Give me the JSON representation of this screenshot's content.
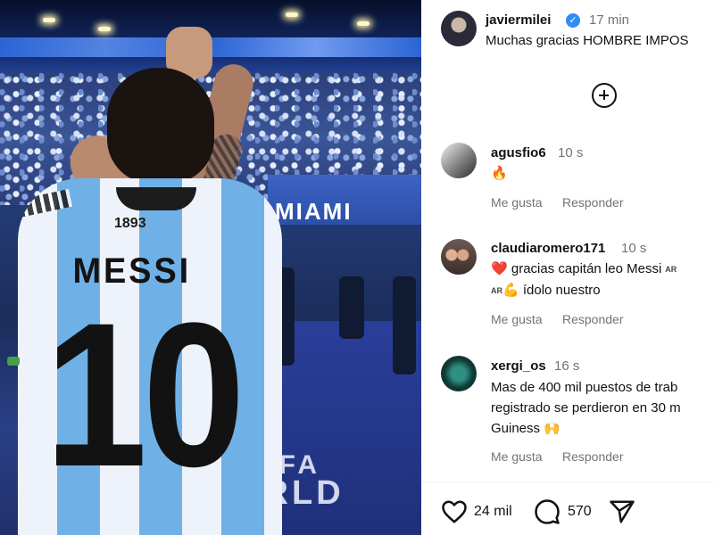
{
  "photo": {
    "banner_text": "MIAMI",
    "field_text_1": "FIFA",
    "field_text_2": "ORLD",
    "jersey_crest": "1893",
    "jersey_name": "MESSI",
    "jersey_number": "10"
  },
  "post": {
    "username": "javiermilei",
    "time": "17 min",
    "caption": "Muchas gracias HOMBRE IMPOS"
  },
  "comments": [
    {
      "username": "agusfio6",
      "time": "10 s",
      "text": "🔥",
      "like_label": "Me gusta",
      "reply_label": "Responder"
    },
    {
      "username": "claudiaromero171",
      "time": "10 s",
      "line1_emoji": "❤️",
      "line1": "gracias capitán leo Messi",
      "flag1": "AR",
      "flag2": "AR",
      "line2_emoji": "💪",
      "line2": "ídolo nuestro",
      "like_label": "Me gusta",
      "reply_label": "Responder"
    },
    {
      "username": "xergi_os",
      "time": "16 s",
      "line1": "Mas de 400 mil puestos de trab",
      "line2": "registrado se perdieron en 30 m",
      "line3": "Guiness 🙌",
      "like_label": "Me gusta",
      "reply_label": "Responder"
    }
  ],
  "actions": {
    "likes": "24 mil",
    "comments": "570"
  },
  "colors": {
    "verified": "#2f8bf5",
    "muted_text": "#737373",
    "jersey_blue": "#6fb1e6"
  }
}
